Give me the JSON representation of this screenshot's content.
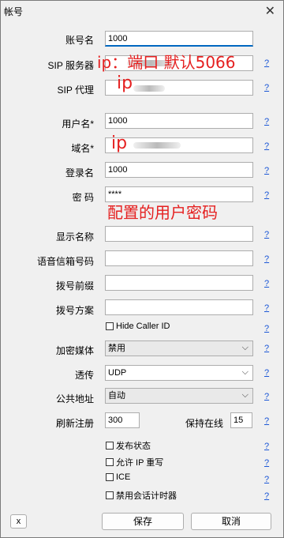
{
  "window": {
    "title": "帐号",
    "close_glyph": "✕"
  },
  "fields": {
    "account_name": {
      "label": "账号名",
      "value": "1000"
    },
    "sip_server": {
      "label": "SIP 服务器"
    },
    "sip_proxy": {
      "label": "SIP 代理"
    },
    "username": {
      "label": "用户名*",
      "value": "1000"
    },
    "domain": {
      "label": "域名*"
    },
    "login": {
      "label": "登录名",
      "value": "1000"
    },
    "password": {
      "label": "密 码",
      "value": "****"
    },
    "display_name": {
      "label": "显示名称"
    },
    "voicemail": {
      "label": "语音信箱号码"
    },
    "dial_prefix": {
      "label": "拨号前缀"
    },
    "dial_plan": {
      "label": "拨号方案"
    },
    "hide_caller_id": {
      "label": "Hide Caller ID"
    },
    "encryption": {
      "label": "加密媒体",
      "value": "禁用"
    },
    "transport": {
      "label": "透传",
      "value": "UDP"
    },
    "public_address": {
      "label": "公共地址",
      "value": "自动"
    },
    "refresh_register": {
      "label": "刷新注册",
      "value": "300"
    },
    "keep_alive": {
      "label": "保持在线",
      "value": "15"
    }
  },
  "checkboxes": {
    "publish_presence": "发布状态",
    "allow_ip_rewrite": "允许 IP 重写",
    "ice": "ICE",
    "disable_session_timer": "禁用会话计时器"
  },
  "help_label": "?",
  "buttons": {
    "x": "x",
    "save": "保存",
    "cancel": "取消"
  },
  "annotations": {
    "sip_server_note": "ip：端口 默认5066",
    "proxy_note": "ip",
    "domain_note": "ip",
    "password_note": "配置的用户密码"
  },
  "colors": {
    "annotation": "#e52020",
    "link": "#1a56d6",
    "focus": "#0067c0"
  }
}
